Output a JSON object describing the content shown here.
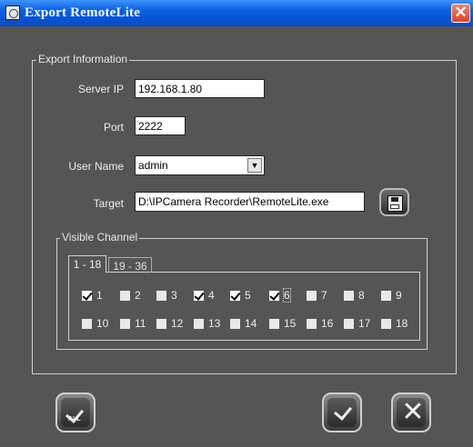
{
  "window": {
    "title": "Export RemoteLite",
    "close_glyph": "✕"
  },
  "export_info": {
    "legend": "Export Information",
    "server_ip": {
      "label": "Server IP",
      "value": "192.168.1.80"
    },
    "port": {
      "label": "Port",
      "value": "2222"
    },
    "user_name": {
      "label": "User Name",
      "value": "admin",
      "arrow": "▼"
    },
    "target": {
      "label": "Target",
      "value": "D:\\IPCamera Recorder\\RemoteLite.exe"
    }
  },
  "visible_channel": {
    "legend": "Visible Channel",
    "tabs": [
      {
        "label": "1 - 18"
      },
      {
        "label": "19 - 36"
      }
    ],
    "channels": [
      {
        "label": "1",
        "checked": true
      },
      {
        "label": "2",
        "checked": false
      },
      {
        "label": "3",
        "checked": false
      },
      {
        "label": "4",
        "checked": true
      },
      {
        "label": "5",
        "checked": true
      },
      {
        "label": "6",
        "checked": true,
        "focused": true
      },
      {
        "label": "7",
        "checked": false
      },
      {
        "label": "8",
        "checked": false
      },
      {
        "label": "9",
        "checked": false
      },
      {
        "label": "10",
        "checked": false
      },
      {
        "label": "11",
        "checked": false
      },
      {
        "label": "12",
        "checked": false
      },
      {
        "label": "13",
        "checked": false
      },
      {
        "label": "14",
        "checked": false
      },
      {
        "label": "15",
        "checked": false
      },
      {
        "label": "16",
        "checked": false
      },
      {
        "label": "17",
        "checked": false
      },
      {
        "label": "18",
        "checked": false
      }
    ]
  },
  "buttons": {
    "select_all": {
      "text": "ALL",
      "icon": "check-all-icon"
    },
    "ok": {
      "icon": "check-icon"
    },
    "cancel": {
      "icon": "close-icon",
      "glyph": "✕"
    },
    "save": {
      "icon": "floppy-disk-icon"
    }
  }
}
